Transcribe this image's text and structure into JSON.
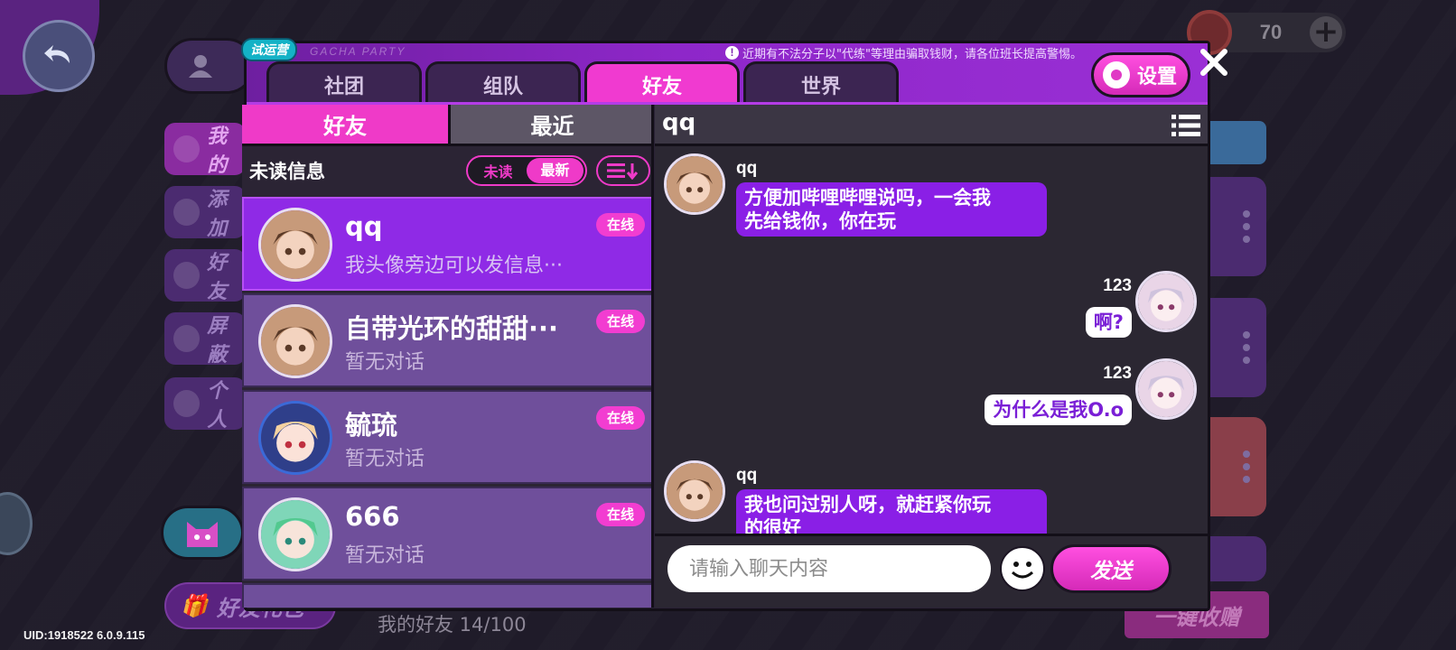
{
  "background": {
    "uid_text": "UID:1918522 6.0.9.115",
    "currency_value": "70",
    "friend_count": "我的好友 14/100",
    "collect_all_label": "一键收赠",
    "gift_label": "好友礼包",
    "menu_items": [
      "我的",
      "添加",
      "好友",
      "屏蔽",
      "个人"
    ]
  },
  "dialog": {
    "trial_badge": "试运营",
    "logo_text": "GACHA PARTY",
    "notice": "近期有不法分子以\"代练\"等理由骗取钱财，请各位班长提高警惕。",
    "tabs": [
      {
        "label": "社团",
        "active": false
      },
      {
        "label": "组队",
        "active": false
      },
      {
        "label": "好友",
        "active": true
      },
      {
        "label": "世界",
        "active": false
      }
    ],
    "settings_label": "设置",
    "subtabs": {
      "friends": "好友",
      "recent": "最近"
    },
    "unread_label": "未读信息",
    "toggle": {
      "unread": "未读",
      "latest": "最新"
    },
    "friends": [
      {
        "name": "qq",
        "last_message": "我头像旁边可以发信息···",
        "status": "在线",
        "selected": true
      },
      {
        "name": "自带光环的甜甜···",
        "last_message": "暂无对话",
        "status": "在线",
        "selected": false
      },
      {
        "name": "毓琉",
        "last_message": "暂无对话",
        "status": "在线",
        "selected": false
      },
      {
        "name": "666",
        "last_message": "暂无对话",
        "status": "在线",
        "selected": false
      }
    ],
    "chat": {
      "title": "qq",
      "messages": [
        {
          "sender": "qq",
          "side": "in",
          "lines": [
            "方便加哔哩哔哩说吗，一会我",
            "先给钱你，你在玩"
          ]
        },
        {
          "sender": "123",
          "side": "out",
          "lines": [
            "啊?"
          ]
        },
        {
          "sender": "123",
          "side": "out",
          "lines": [
            "为什么是我O.o"
          ]
        },
        {
          "sender": "qq",
          "side": "in",
          "lines": [
            "我也问过别人呀，就赶紧你玩",
            "的很好"
          ]
        }
      ],
      "input_placeholder": "请输入聊天内容",
      "send_label": "发送"
    }
  },
  "colors": {
    "accent_pink": "#ef3ac8",
    "header_purple": "#8e27c9",
    "bubble_purple": "#8a1fe6",
    "friend_row": "#6f4f9b"
  }
}
